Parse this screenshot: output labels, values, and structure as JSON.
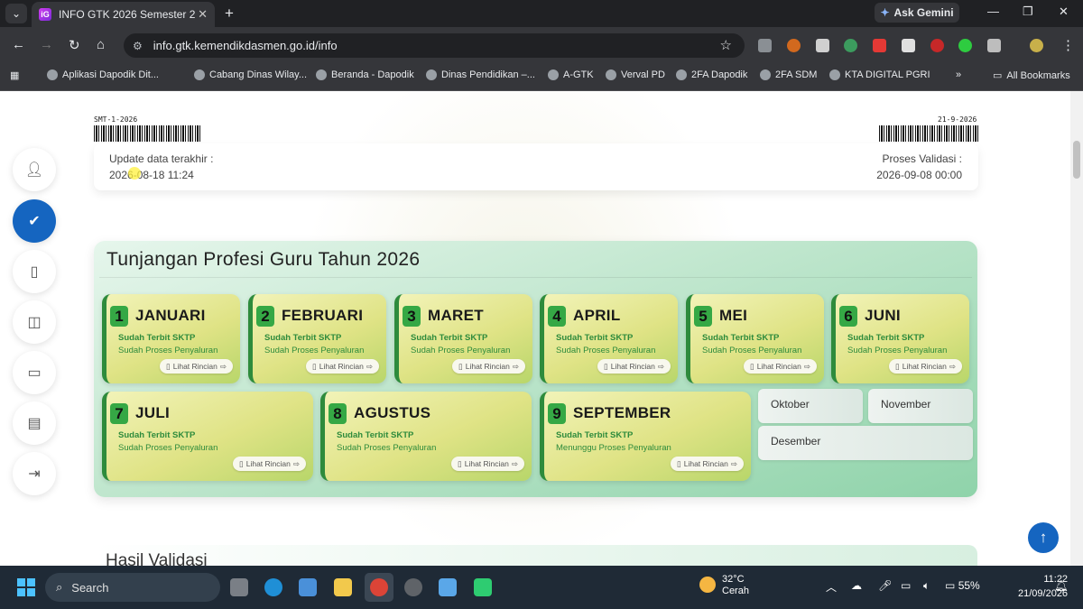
{
  "browser": {
    "tab_title": "INFO GTK 2026 Semester 2",
    "tab_favicon": "iG",
    "gemini_label": "Ask Gemini",
    "url": "info.gtk.kemendikdasmen.go.id/info",
    "bookmarks": [
      "Aplikasi Dapodik Dit...",
      "Cabang Dinas Wilay...",
      "Beranda - Dapodik",
      "Dinas Pendidikan –...",
      "A-GTK",
      "Verval PD",
      "2FA Dapodik",
      "2FA SDM",
      "KTA DIGITAL PGRI"
    ],
    "all_bookmarks": "All Bookmarks"
  },
  "header": {
    "barcode_left": "SMT-1-2026",
    "barcode_right": "21-9-2026",
    "update_label": "Update data terakhir :",
    "update_value": "2026-08-18 11:24",
    "validasi_label": "Proses Validasi :",
    "validasi_value": "2026-09-08 00:00"
  },
  "panel": {
    "title": "Tunjangan Profesi Guru Tahun 2026",
    "detail_label": "Lihat Rincian",
    "months": [
      {
        "num": "1",
        "name": "JANUARI",
        "status1": "Sudah Terbit SKTP",
        "status2": "Sudah Proses Penyaluran"
      },
      {
        "num": "2",
        "name": "FEBRUARI",
        "status1": "Sudah Terbit SKTP",
        "status2": "Sudah Proses Penyaluran"
      },
      {
        "num": "3",
        "name": "MARET",
        "status1": "Sudah Terbit SKTP",
        "status2": "Sudah Proses Penyaluran"
      },
      {
        "num": "4",
        "name": "APRIL",
        "status1": "Sudah Terbit SKTP",
        "status2": "Sudah Proses Penyaluran"
      },
      {
        "num": "5",
        "name": "MEI",
        "status1": "Sudah Terbit SKTP",
        "status2": "Sudah Proses Penyaluran"
      },
      {
        "num": "6",
        "name": "JUNI",
        "status1": "Sudah Terbit SKTP",
        "status2": "Sudah Proses Penyaluran"
      },
      {
        "num": "7",
        "name": "JULI",
        "status1": "Sudah Terbit SKTP",
        "status2": "Sudah Proses Penyaluran"
      },
      {
        "num": "8",
        "name": "AGUSTUS",
        "status1": "Sudah Terbit SKTP",
        "status2": "Sudah Proses Penyaluran"
      },
      {
        "num": "9",
        "name": "SEPTEMBER",
        "status1": "Sudah Terbit SKTP",
        "status2": "Menunggu Proses Penyaluran"
      }
    ],
    "pending_months": [
      "Oktober",
      "November",
      "Desember"
    ]
  },
  "next_section_title": "Hasil Validasi",
  "taskbar": {
    "search_label": "Search",
    "temperature": "32°C",
    "weather": "Cerah",
    "battery": "55%",
    "time": "11:22",
    "date": "21/09/2026"
  },
  "colors": {
    "accent": "#1565c0",
    "month_green": "#2e8b3c"
  }
}
